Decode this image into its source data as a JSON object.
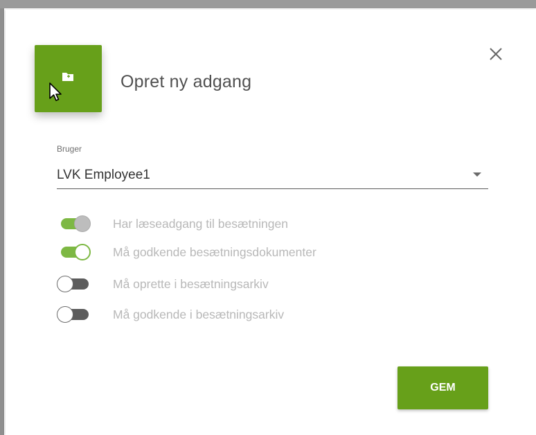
{
  "dialog": {
    "title": "Opret ny adgang",
    "header_icon": "folder-add-icon",
    "close_icon": "close-icon"
  },
  "user_field": {
    "label": "Bruger",
    "value": "LVK Employee1"
  },
  "permissions": [
    {
      "label": "Har læseadgang til besætningen",
      "checked": true,
      "disabled": true
    },
    {
      "label": "Må godkende besætningsdokumenter",
      "checked": true,
      "disabled": false
    },
    {
      "label": "Må oprette i besætningsarkiv",
      "checked": false,
      "disabled": false
    },
    {
      "label": "Må godkende i besætningsarkiv",
      "checked": false,
      "disabled": false
    }
  ],
  "actions": {
    "save_label": "GEM"
  },
  "colors": {
    "primary_green": "#67a01a",
    "toggle_on": "#7db843",
    "toggle_off": "#5c5c5c"
  }
}
